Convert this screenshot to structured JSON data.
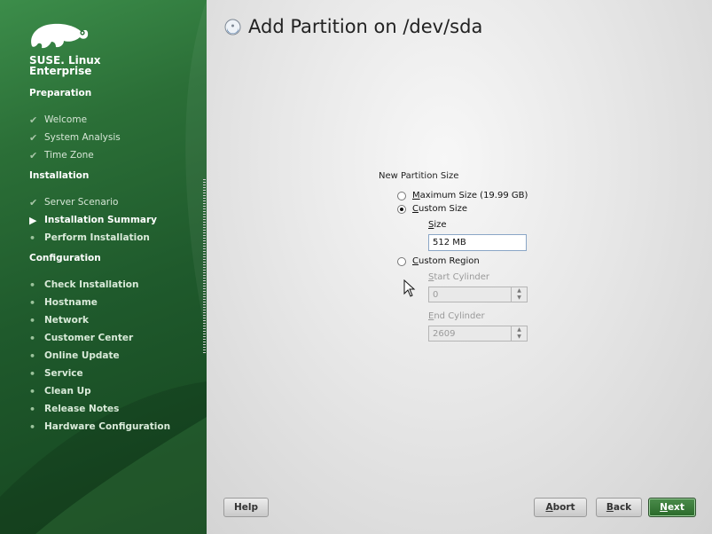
{
  "brand": {
    "line1": "SUSE. Linux",
    "line2": "Enterprise"
  },
  "sidebar": {
    "sections": [
      {
        "title": "Preparation",
        "steps": [
          {
            "label": "Welcome",
            "state": "done"
          },
          {
            "label": "System Analysis",
            "state": "done"
          },
          {
            "label": "Time Zone",
            "state": "done"
          }
        ]
      },
      {
        "title": "Installation",
        "steps": [
          {
            "label": "Server Scenario",
            "state": "done"
          },
          {
            "label": "Installation Summary",
            "state": "current"
          },
          {
            "label": "Perform Installation",
            "state": "todo"
          }
        ]
      },
      {
        "title": "Configuration",
        "steps": [
          {
            "label": "Check Installation",
            "state": "todo"
          },
          {
            "label": "Hostname",
            "state": "todo"
          },
          {
            "label": "Network",
            "state": "todo"
          },
          {
            "label": "Customer Center",
            "state": "todo"
          },
          {
            "label": "Online Update",
            "state": "todo"
          },
          {
            "label": "Service",
            "state": "todo"
          },
          {
            "label": "Clean Up",
            "state": "todo"
          },
          {
            "label": "Release Notes",
            "state": "todo"
          },
          {
            "label": "Hardware Configuration",
            "state": "todo"
          }
        ]
      }
    ]
  },
  "main": {
    "title": "Add Partition on /dev/sda",
    "frame_label": "New Partition Size",
    "options": {
      "max": {
        "hot": "M",
        "rest": "aximum Size (19.99 GB)",
        "selected": false
      },
      "custom": {
        "hot": "C",
        "rest": "ustom Size",
        "selected": true
      },
      "region": {
        "hot": "C",
        "rest": "ustom Region",
        "selected": false
      }
    },
    "size": {
      "hot": "S",
      "rest": "ize",
      "value": "512 MB"
    },
    "start_cylinder": {
      "hot": "S",
      "rest": "tart Cylinder",
      "value": "0",
      "enabled": false
    },
    "end_cylinder": {
      "hot": "E",
      "rest": "nd Cylinder",
      "value": "2609",
      "enabled": false
    }
  },
  "buttons": {
    "help": "Help",
    "abort": {
      "hot": "A",
      "rest": "bort"
    },
    "back": {
      "hot": "B",
      "rest": "ack"
    },
    "next": {
      "hot": "N",
      "rest": "ext"
    }
  },
  "colors": {
    "sidebar_green": "#1f5a2c",
    "next_button": "#3b7d3b"
  }
}
